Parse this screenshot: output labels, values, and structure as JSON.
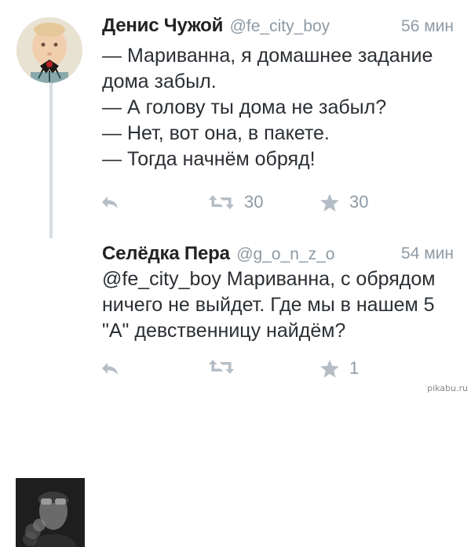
{
  "tweets": [
    {
      "author": "Денис Чужой",
      "handle": "@fe_city_boy",
      "time": "56 мин",
      "lines": [
        "— Мариванна, я домашнее задание",
        "дома забыл.",
        "— А голову ты дома не забыл?",
        "— Нет, вот она, в пакете.",
        "— Тогда начнём обряд!"
      ],
      "retweets": "30",
      "favorites": "30"
    },
    {
      "author": "Селёдка Пера",
      "handle": "@g_o_n_z_o",
      "time": "54 мин",
      "lines": [
        "@fe_city_boy Мариванна, с обрядом",
        "ничего не выйдет. Где мы в нашем 5",
        "\"А\" девственницу найдём?"
      ],
      "retweets": "",
      "favorites": "1"
    }
  ],
  "watermark": "pikabu.ru",
  "icons": {
    "reply": "reply-icon",
    "retweet": "retweet-icon",
    "favorite": "star-icon"
  },
  "colors": {
    "text": "#2b2f33",
    "muted": "#8e9aa4",
    "icon": "#b5bec6",
    "thread_line": "#d8dde2"
  }
}
